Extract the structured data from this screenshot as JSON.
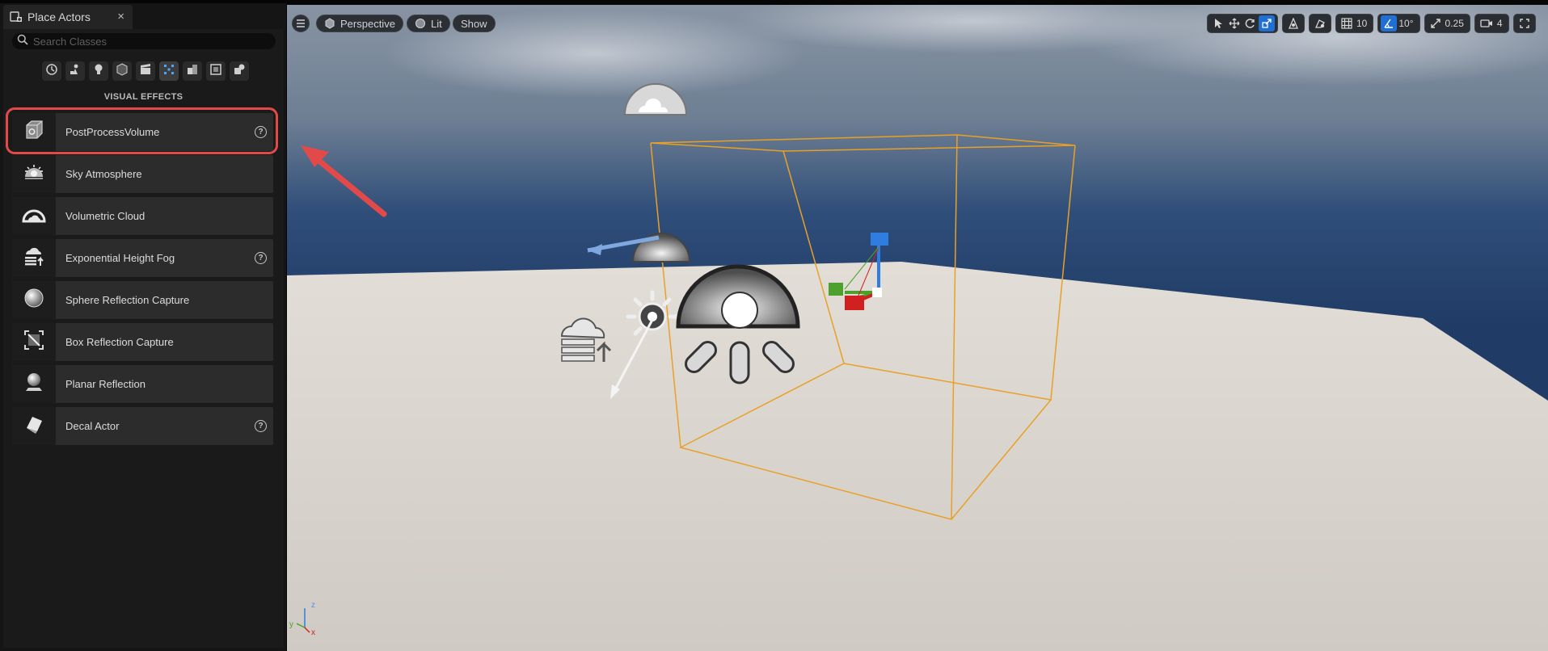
{
  "panel": {
    "tab_title": "Place Actors",
    "close_glyph": "×",
    "search_placeholder": "Search Classes",
    "section_title": "VISUAL EFFECTS",
    "categories": [
      {
        "icon": "clock-icon"
      },
      {
        "icon": "basic-actors-icon"
      },
      {
        "icon": "lights-icon"
      },
      {
        "icon": "shapes-icon"
      },
      {
        "icon": "cinematic-icon"
      },
      {
        "icon": "visual-effects-icon",
        "active": true
      },
      {
        "icon": "geometry-icon"
      },
      {
        "icon": "volumes-icon"
      },
      {
        "icon": "all-classes-icon"
      }
    ],
    "items": [
      {
        "label": "PostProcessVolume",
        "icon": "postprocess-volume-icon",
        "help": true
      },
      {
        "label": "Sky Atmosphere",
        "icon": "sky-atmosphere-icon",
        "help": false
      },
      {
        "label": "Volumetric Cloud",
        "icon": "volumetric-cloud-icon",
        "help": false
      },
      {
        "label": "Exponential Height Fog",
        "icon": "height-fog-icon",
        "help": true
      },
      {
        "label": "Sphere Reflection Capture",
        "icon": "sphere-reflection-icon",
        "help": false
      },
      {
        "label": "Box Reflection Capture",
        "icon": "box-reflection-icon",
        "help": false
      },
      {
        "label": "Planar Reflection",
        "icon": "planar-reflection-icon",
        "help": false
      },
      {
        "label": "Decal Actor",
        "icon": "decal-actor-icon",
        "help": true
      }
    ]
  },
  "viewport": {
    "view_mode": "Perspective",
    "lighting_mode": "Lit",
    "show_label": "Show",
    "grid_snap": "10",
    "rotation_snap": "10°",
    "scale_snap": "0.25",
    "camera_speed": "4",
    "axis_labels": {
      "x": "x",
      "y": "y",
      "z": "z"
    },
    "colors": {
      "selection_box": "#e8a028",
      "highlight": "#e24a4a",
      "accent": "#1f6fd4"
    }
  }
}
